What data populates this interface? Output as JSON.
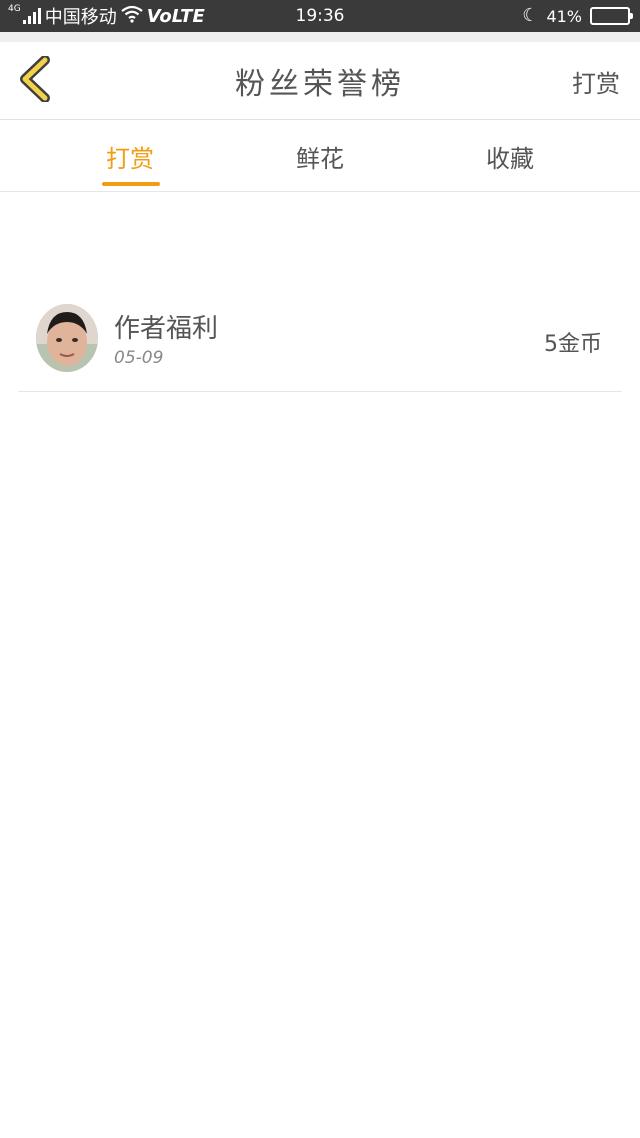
{
  "status_bar": {
    "network": "4G",
    "carrier": "中国移动",
    "volte": "VoLTE",
    "time": "19:36",
    "battery_text": "41%",
    "battery_level": 0.41,
    "battery_color": "#2f8de4"
  },
  "nav": {
    "title": "粉丝荣誉榜",
    "action_label": "打赏",
    "back_icon": "chevron-left-icon",
    "back_icon_color": "#f3d24a"
  },
  "tabs": [
    {
      "label": "打赏",
      "active": true
    },
    {
      "label": "鲜花",
      "active": false
    },
    {
      "label": "收藏",
      "active": false
    }
  ],
  "accent_color": "#f39c12",
  "records": [
    {
      "name": "作者福利",
      "date": "05-09",
      "amount": "5金币"
    }
  ]
}
